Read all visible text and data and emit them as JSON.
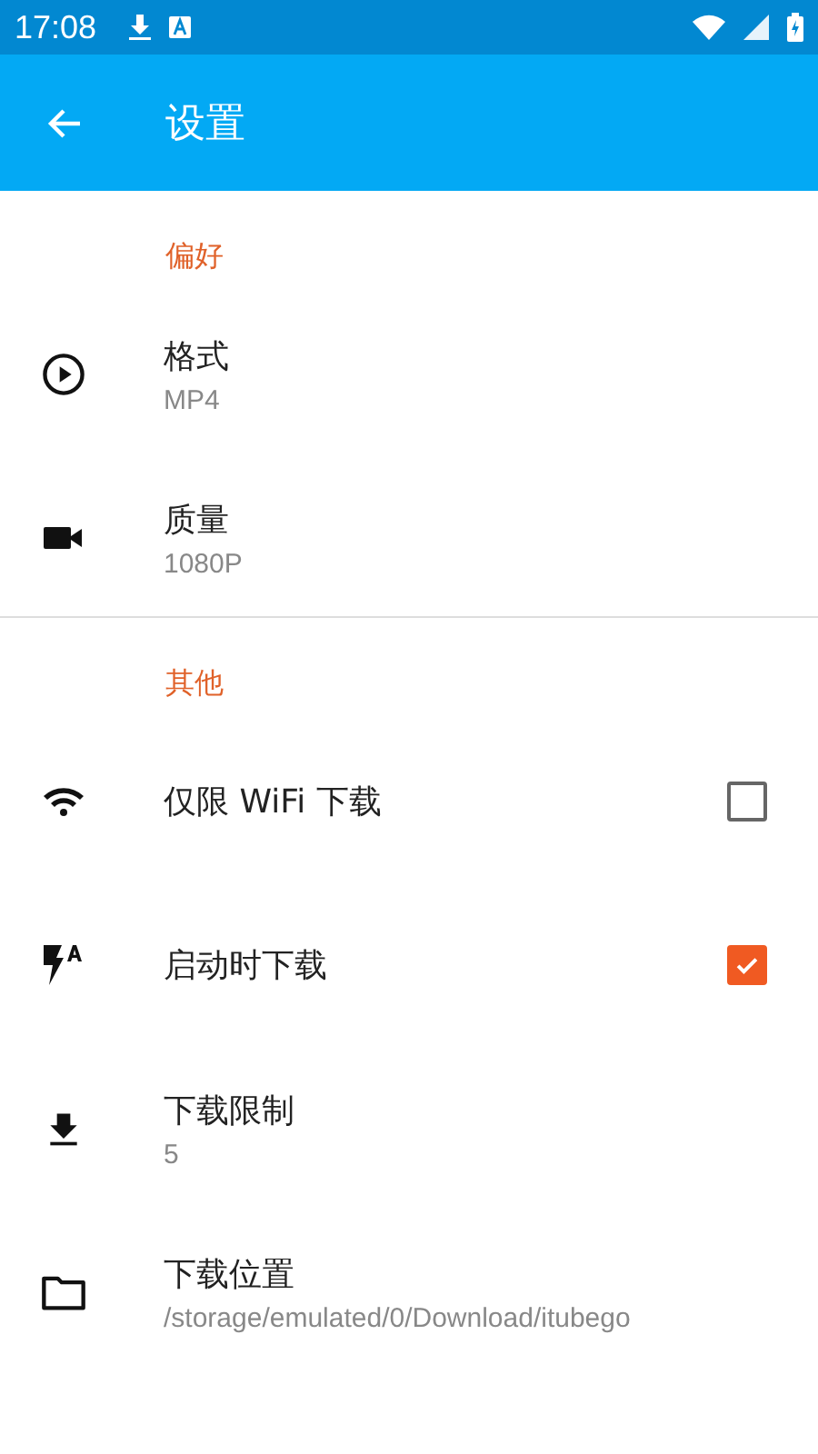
{
  "status_bar": {
    "time": "17:08"
  },
  "app_bar": {
    "title": "设置"
  },
  "sections": [
    {
      "header": "偏好",
      "items": [
        {
          "kind": "value",
          "title": "格式",
          "value": "MP4"
        },
        {
          "kind": "value",
          "title": "质量",
          "value": "1080P"
        }
      ]
    },
    {
      "header": "其他",
      "items": [
        {
          "kind": "checkbox",
          "title": "仅限 WiFi 下载",
          "checked": false
        },
        {
          "kind": "checkbox",
          "title": "启动时下载",
          "checked": true
        },
        {
          "kind": "value",
          "title": "下载限制",
          "value": "5"
        },
        {
          "kind": "value",
          "title": "下载位置",
          "value": "/storage/emulated/0/Download/itubego"
        }
      ]
    }
  ]
}
